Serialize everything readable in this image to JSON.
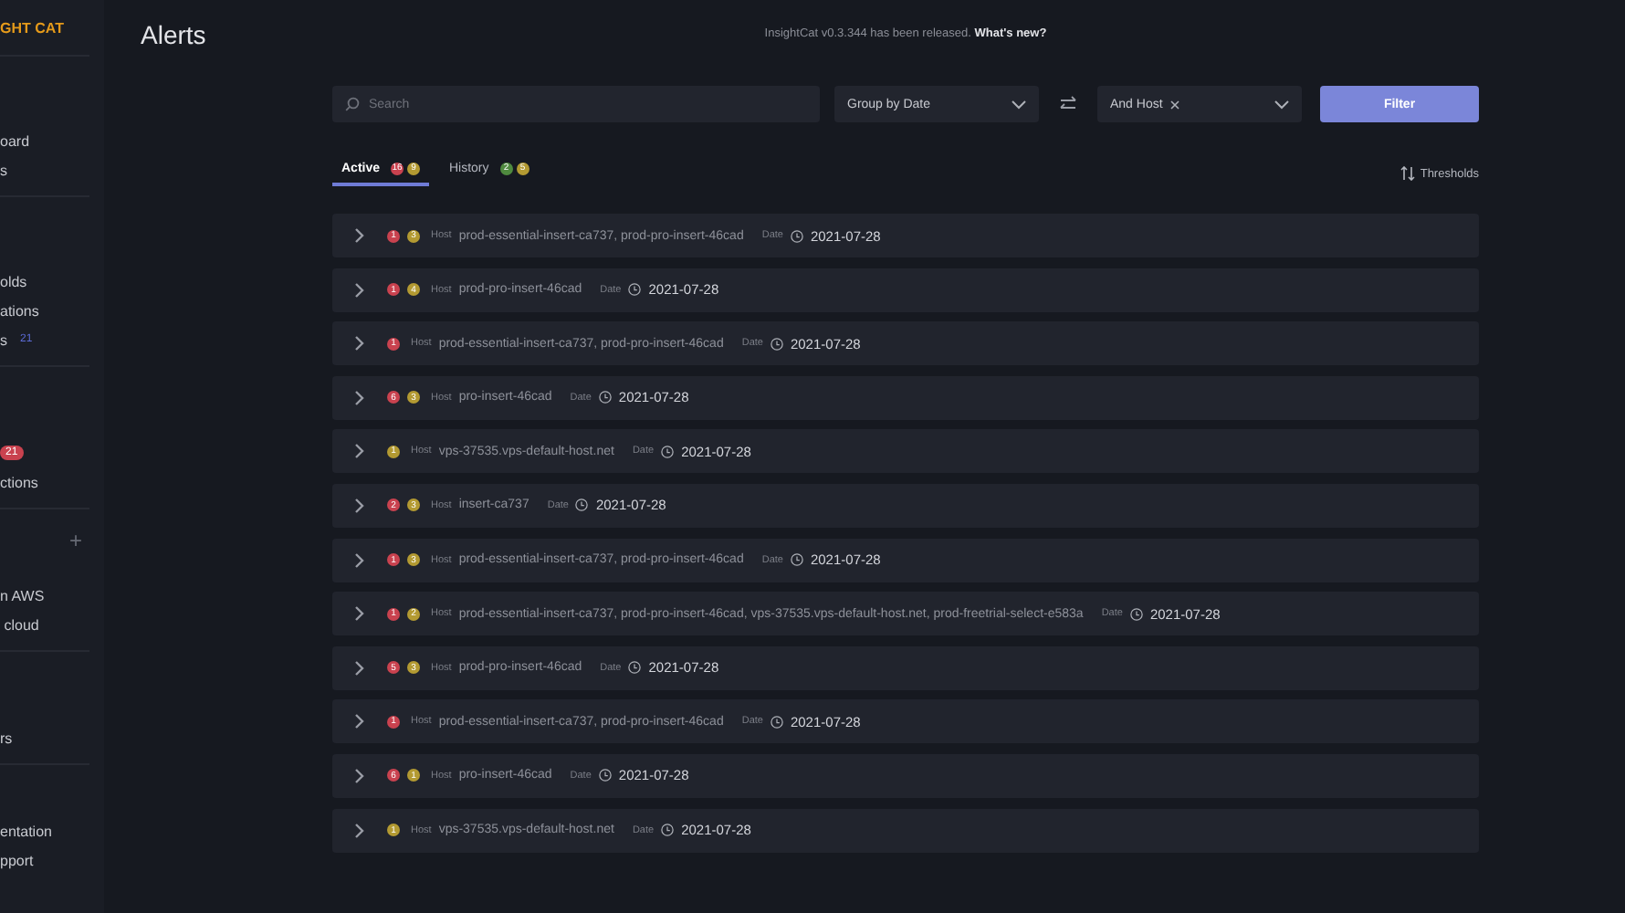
{
  "sidebar": {
    "logo": "GHT CAT",
    "sections": [
      {
        "items": [
          {
            "label": "oard"
          },
          {
            "label": "s"
          }
        ]
      },
      {
        "items": [
          {
            "label": "olds"
          },
          {
            "label": "ations"
          },
          {
            "label": "s",
            "count": "21",
            "color": "#5b6bd6"
          }
        ]
      },
      {
        "items": [
          {
            "count": "21",
            "color": "#c9424f"
          },
          {
            "label": "ctions"
          }
        ]
      },
      {
        "add": "+",
        "items": [
          {
            "label": "n AWS"
          },
          {
            "label": " cloud"
          }
        ]
      },
      {
        "items": [
          {
            "label": "rs"
          }
        ]
      },
      {
        "items": [
          {
            "label": "entation"
          },
          {
            "label": "pport"
          }
        ]
      }
    ]
  },
  "page_title": "Alerts",
  "release_note": {
    "text": "InsightCat v0.3.344 has been released.",
    "link": "What's new?"
  },
  "search": {
    "placeholder": "Search"
  },
  "group_by": {
    "value": "Group by Date"
  },
  "host_filter": {
    "chip": "And Host"
  },
  "filter_button": "Filter",
  "tabs": [
    {
      "label": "Active",
      "selected": true,
      "counts": [
        {
          "text": "16",
          "color": "#c9424f"
        },
        {
          "text": "9",
          "color": "#b39a32"
        }
      ]
    },
    {
      "label": "History",
      "selected": false,
      "counts": [
        {
          "text": "2",
          "color": "#4f8a3f"
        },
        {
          "text": "5",
          "color": "#b39a32"
        }
      ]
    }
  ],
  "thresholds": "Thresholds",
  "alerts": [
    {
      "counts": [
        {
          "text": "1",
          "color": "#c9424f"
        },
        {
          "text": "3",
          "color": "#b39a32"
        }
      ],
      "host_label": "Host",
      "hosts": "prod-essential-insert-ca737, prod-pro-insert-46cad",
      "date_label": "Date",
      "date": "2021-07-28"
    },
    {
      "counts": [
        {
          "text": "1",
          "color": "#c9424f"
        },
        {
          "text": "4",
          "color": "#b39a32"
        }
      ],
      "host_label": "Host",
      "hosts": "prod-pro-insert-46cad",
      "date_label": "Date",
      "date": "2021-07-28"
    },
    {
      "counts": [
        {
          "text": "1",
          "color": "#c9424f"
        }
      ],
      "host_label": "Host",
      "hosts": "prod-essential-insert-ca737, prod-pro-insert-46cad",
      "date_label": "Date",
      "date": "2021-07-28"
    },
    {
      "counts": [
        {
          "text": "6",
          "color": "#c9424f"
        },
        {
          "text": "3",
          "color": "#b39a32"
        }
      ],
      "host_label": "Host",
      "hosts": "pro-insert-46cad",
      "date_label": "Date",
      "date": "2021-07-28"
    },
    {
      "counts": [
        {
          "text": "1",
          "color": "#b39a32"
        }
      ],
      "host_label": "Host",
      "hosts": "vps-37535.vps-default-host.net",
      "date_label": "Date",
      "date": "2021-07-28"
    },
    {
      "counts": [
        {
          "text": "2",
          "color": "#c9424f"
        },
        {
          "text": "3",
          "color": "#b39a32"
        }
      ],
      "host_label": "Host",
      "hosts": "insert-ca737",
      "date_label": "Date",
      "date": "2021-07-28"
    },
    {
      "counts": [
        {
          "text": "1",
          "color": "#c9424f"
        },
        {
          "text": "3",
          "color": "#b39a32"
        }
      ],
      "host_label": "Host",
      "hosts": "prod-essential-insert-ca737, prod-pro-insert-46cad",
      "date_label": "Date",
      "date": "2021-07-28"
    },
    {
      "counts": [
        {
          "text": "1",
          "color": "#c9424f"
        },
        {
          "text": "2",
          "color": "#b39a32"
        }
      ],
      "host_label": "Host",
      "hosts": "prod-essential-insert-ca737, prod-pro-insert-46cad, vps-37535.vps-default-host.net, prod-freetrial-select-e583a",
      "date_label": "Date",
      "date": "2021-07-28"
    },
    {
      "counts": [
        {
          "text": "5",
          "color": "#c9424f"
        },
        {
          "text": "3",
          "color": "#b39a32"
        }
      ],
      "host_label": "Host",
      "hosts": "prod-pro-insert-46cad",
      "date_label": "Date",
      "date": "2021-07-28"
    },
    {
      "counts": [
        {
          "text": "1",
          "color": "#c9424f"
        }
      ],
      "host_label": "Host",
      "hosts": "prod-essential-insert-ca737, prod-pro-insert-46cad",
      "date_label": "Date",
      "date": "2021-07-28"
    },
    {
      "counts": [
        {
          "text": "6",
          "color": "#c9424f"
        },
        {
          "text": "1",
          "color": "#b39a32"
        }
      ],
      "host_label": "Host",
      "hosts": "pro-insert-46cad",
      "date_label": "Date",
      "date": "2021-07-28"
    },
    {
      "counts": [
        {
          "text": "1",
          "color": "#b39a32"
        }
      ],
      "host_label": "Host",
      "hosts": "vps-37535.vps-default-host.net",
      "date_label": "Date",
      "date": "2021-07-28"
    }
  ]
}
